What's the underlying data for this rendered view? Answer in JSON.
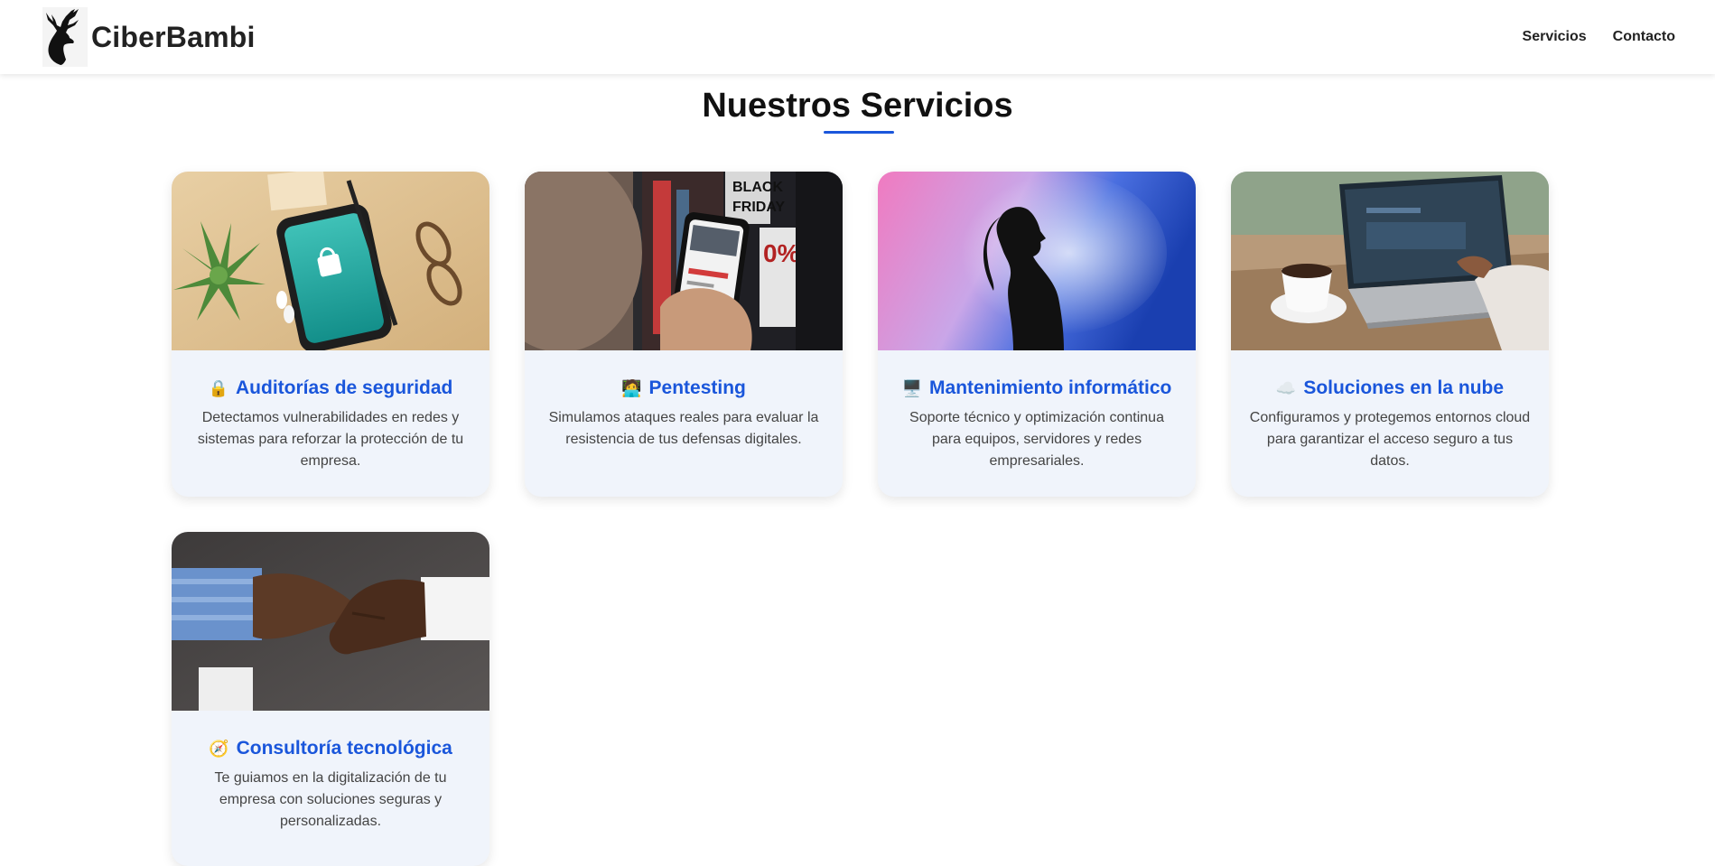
{
  "header": {
    "brand_name": "CiberBambi",
    "nav": [
      {
        "label": "Servicios"
      },
      {
        "label": "Contacto"
      }
    ]
  },
  "section": {
    "title": "Nuestros Servicios"
  },
  "services": [
    {
      "icon": "lock-icon",
      "emoji": "🔒",
      "title": "Auditorías de seguridad",
      "description": "Detectamos vulnerabilidades en redes y sistemas para reforzar la protección de tu empresa."
    },
    {
      "icon": "hacker-icon",
      "emoji": "🧑‍💻",
      "title": "Pentesting",
      "description": "Simulamos ataques reales para evaluar la resistencia de tus defensas digitales."
    },
    {
      "icon": "desktop-icon",
      "emoji": "🖥️",
      "title": "Mantenimiento informático",
      "description": "Soporte técnico y optimización continua para equipos, servidores y redes empresariales."
    },
    {
      "icon": "cloud-icon",
      "emoji": "☁️",
      "title": "Soluciones en la nube",
      "description": "Configuramos y protegemos entornos cloud para garantizar el acceso seguro a tus datos."
    },
    {
      "icon": "compass-icon",
      "emoji": "🧭",
      "title": "Consultoría tecnológica",
      "description": "Te guiamos en la digitalización de tu empresa con soluciones seguras y personalizadas."
    }
  ],
  "colors": {
    "accent": "#1a56db",
    "card_background": "#f0f4fb",
    "text": "#444444"
  }
}
